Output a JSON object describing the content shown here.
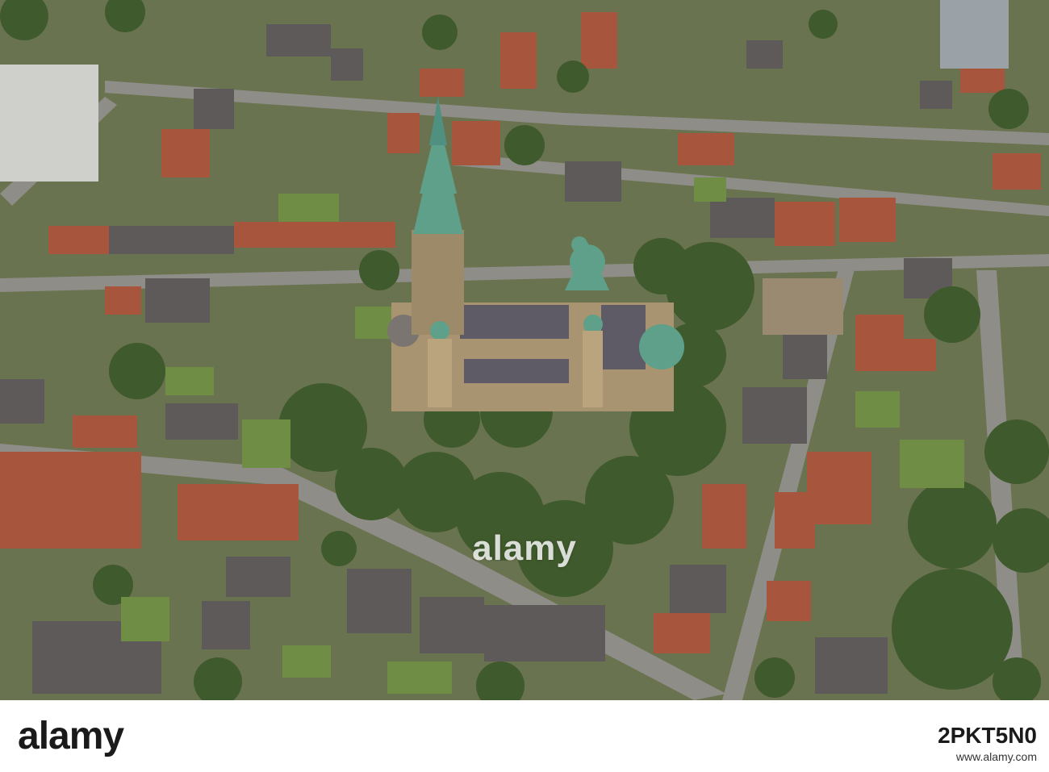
{
  "photo": {
    "description_icon": "aerial-photo",
    "watermark": "alamy"
  },
  "footer": {
    "logo_text": "alamy",
    "image_id": "2PKT5N0",
    "link": "www.alamy.com"
  },
  "colors": {
    "vegetation": "#3f5a2c",
    "roof_red": "#a8553d",
    "roof_grey": "#5e5a5a",
    "copper": "#5fa08a",
    "stone": "#a89470",
    "road": "#8e8c86"
  }
}
